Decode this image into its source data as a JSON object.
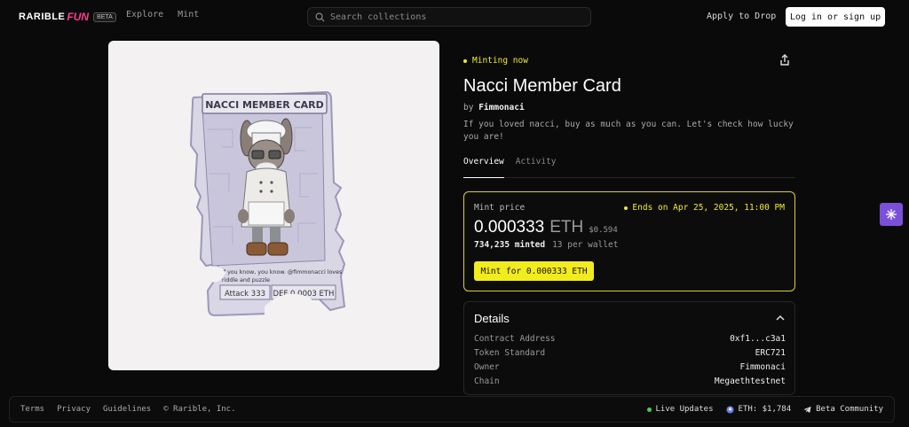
{
  "header": {
    "logo_text": "RARIBLE",
    "logo_accent": "FUN",
    "logo_badge": "BETA",
    "nav": [
      "Explore",
      "Mint"
    ],
    "search_placeholder": "Search collections",
    "apply_label": "Apply to Drop",
    "login_label": "Log in or sign up"
  },
  "card_image": {
    "title": "NACCI MEMBER CARD",
    "caption_line1": "If you know, you know. @fimmonacci loves",
    "caption_line2": "riddle and puzzle",
    "attack": "Attack 333",
    "defense": "DEF 0.0003 ETH"
  },
  "collection": {
    "status": "Minting now",
    "title": "Nacci Member Card",
    "by_prefix": "by",
    "creator": "Fimmonaci",
    "description": "If you loved nacci, buy as much as you can. Let's check how lucky you are!",
    "tabs": [
      "Overview",
      "Activity"
    ]
  },
  "mint": {
    "label": "Mint price",
    "ends": "Ends on Apr 25, 2025, 11:00 PM",
    "price": "0.000333",
    "unit": "ETH",
    "usd": "$0.594",
    "minted": "734,235 minted",
    "per_wallet": "13 per wallet",
    "button": "Mint for 0.000333 ETH"
  },
  "details": {
    "title": "Details",
    "rows": [
      {
        "key": "Contract Address",
        "value": "0xf1...c3a1"
      },
      {
        "key": "Token Standard",
        "value": "ERC721"
      },
      {
        "key": "Owner",
        "value": "Fimmonaci"
      },
      {
        "key": "Chain",
        "value": "Megaethtestnet"
      }
    ]
  },
  "footer": {
    "links": [
      "Terms",
      "Privacy",
      "Guidelines",
      "© Rarible, Inc."
    ],
    "live_updates": "Live Updates",
    "eth_price": "ETH: $1,784",
    "community": "Beta Community"
  },
  "colors": {
    "accent_yellow": "#f2ea2e",
    "brand_pink": "#ff3d8f",
    "side_button_purple": "#7b4fd9",
    "live_green": "#3fd15b"
  }
}
